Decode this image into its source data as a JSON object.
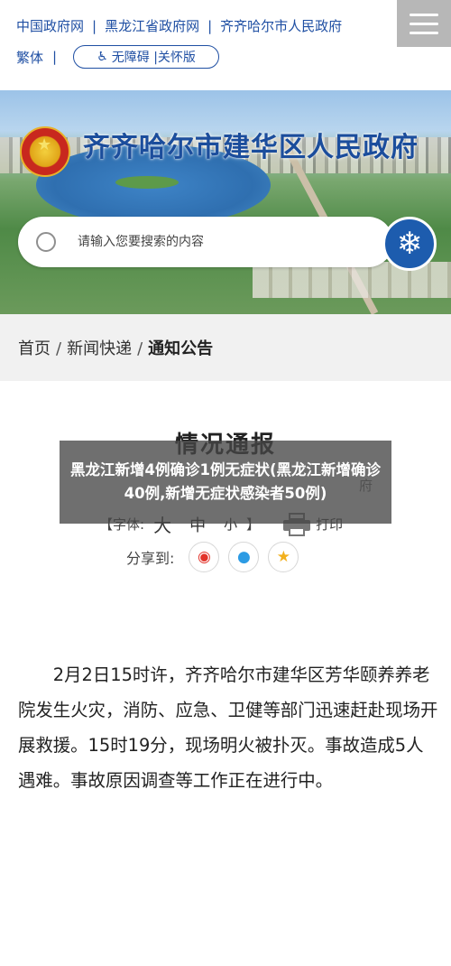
{
  "header": {
    "links": [
      "中国政府网",
      "黑龙江省政府网",
      "齐齐哈尔市人民政府"
    ],
    "traditional": "繁体",
    "accessibility": "无障碍 |关怀版"
  },
  "banner": {
    "site_title": "齐齐哈尔市建华区人民政府",
    "search_placeholder": "请输入您要搜索的内容"
  },
  "breadcrumb": {
    "items": [
      "首页",
      "新闻快递",
      "通知公告"
    ],
    "separator": "/"
  },
  "article": {
    "title": "情况通报",
    "source": "府",
    "font_label": "【字体:",
    "font_large": "大",
    "font_medium": "中",
    "font_small": "小",
    "font_close": "】",
    "print": "打印",
    "share_label": "分享到:",
    "body": "2月2日15时许，齐齐哈尔市建华区芳华颐养养老院发生火灾，消防、应急、卫健等部门迅速赶赴现场开展救援。15时19分，现场明火被扑灭。事故造成5人遇难。事故原因调查等工作正在进行中。"
  },
  "overlay": {
    "caption": "黑龙江新增4例确诊1例无症状(黑龙江新增确诊40例,新增无症状感染者50例)"
  },
  "colors": {
    "link_blue": "#1f4fa3",
    "menu_gray": "#b7b7b7",
    "breadcrumb_bg": "#f1f1f1"
  },
  "icons": {
    "accessibility": "wheelchair-icon",
    "menu": "hamburger-icon",
    "search": "search-ring-icon",
    "snow": "snowflake-icon",
    "print": "printer-icon",
    "share": [
      "weibo-icon",
      "qq-icon",
      "qzone-icon"
    ]
  }
}
